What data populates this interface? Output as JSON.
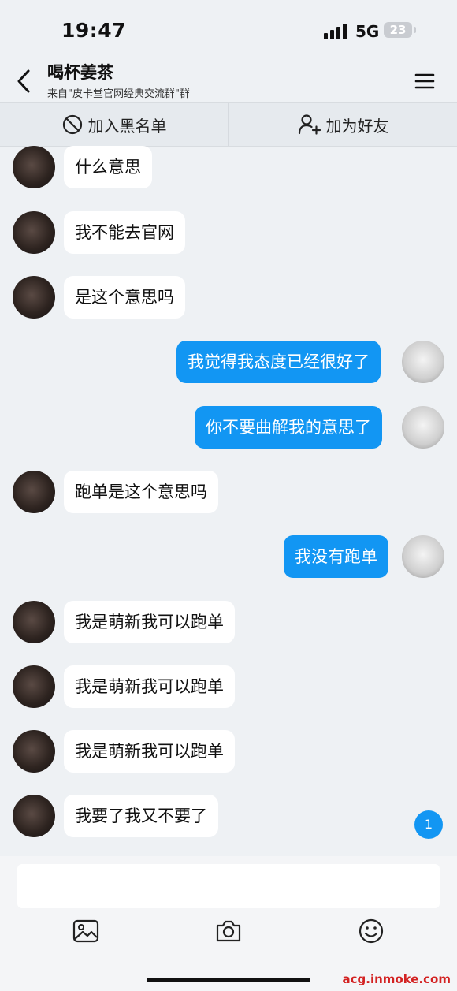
{
  "status_bar": {
    "time": "19:47",
    "network": "5G",
    "battery": "23"
  },
  "header": {
    "title": "喝杯姜茶",
    "subtitle": "来自\"皮卡堂官网经典交流群\"群"
  },
  "actions": {
    "blacklist_label": "加入黑名单",
    "add_friend_label": "加为好友"
  },
  "messages": [
    {
      "side": "incoming",
      "text": "什么意思"
    },
    {
      "side": "incoming",
      "text": "我不能去官网"
    },
    {
      "side": "incoming",
      "text": "是这个意思吗"
    },
    {
      "side": "outgoing",
      "text": "我觉得我态度已经很好了"
    },
    {
      "side": "outgoing",
      "text": "你不要曲解我的意思了"
    },
    {
      "side": "incoming",
      "text": "跑单是这个意思吗"
    },
    {
      "side": "outgoing",
      "text": "我没有跑单"
    },
    {
      "side": "incoming",
      "text": "我是萌新我可以跑单"
    },
    {
      "side": "incoming",
      "text": "我是萌新我可以跑单"
    },
    {
      "side": "incoming",
      "text": "我是萌新我可以跑单"
    },
    {
      "side": "incoming",
      "text": "我要了我又不要了"
    }
  ],
  "unread_count": "1",
  "toolbar": {
    "icons": [
      "image-icon",
      "camera-icon",
      "emoji-icon"
    ]
  },
  "watermark": "acg.inmoke.com"
}
